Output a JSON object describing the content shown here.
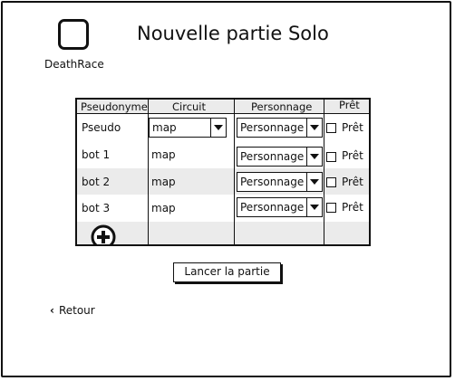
{
  "app": {
    "logo_text": "DeathRace",
    "logo_icon": "rounded-square-icon"
  },
  "page_title": "Nouvelle partie Solo",
  "table": {
    "headers": [
      "Pseudonyme",
      "Circuit",
      "Personnage",
      "Prêt"
    ],
    "rows": [
      {
        "pseudo": "Pseudo",
        "circuit": "map",
        "circuit_is_dropdown": true,
        "personnage": "Personnage",
        "ready_label": "Prêt",
        "ready_checked": false
      },
      {
        "pseudo": "bot 1",
        "circuit": "map",
        "circuit_is_dropdown": false,
        "personnage": "Personnage",
        "ready_label": "Prêt",
        "ready_checked": false
      },
      {
        "pseudo": "bot 2",
        "circuit": "map",
        "circuit_is_dropdown": false,
        "personnage": "Personnage",
        "ready_label": "Prêt",
        "ready_checked": false
      },
      {
        "pseudo": "bot 3",
        "circuit": "map",
        "circuit_is_dropdown": false,
        "personnage": "Personnage",
        "ready_label": "Prêt",
        "ready_checked": false
      }
    ],
    "add_icon": "plus-circle-icon"
  },
  "launch_button": "Lancer la partie",
  "back_link": "Retour",
  "colors": {
    "border": "#111111",
    "row_stripe": "#ebebeb",
    "background": "#ffffff"
  }
}
